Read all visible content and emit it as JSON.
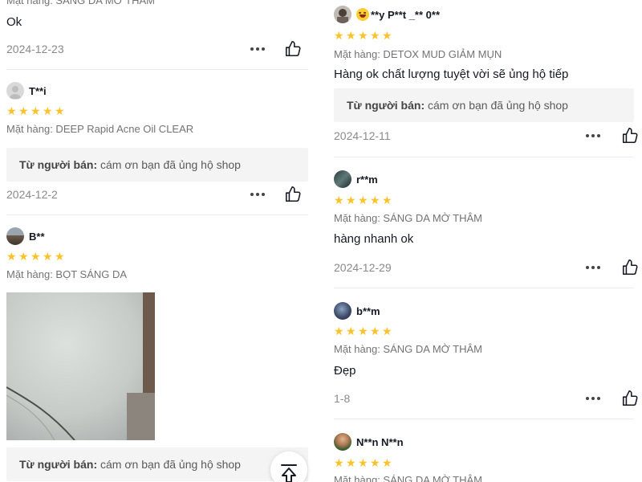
{
  "left_reviews": [
    {
      "variant": "Mặt hàng: SÁNG DA MỜ THÂM",
      "content": "Ok",
      "date": "2024-12-23"
    },
    {
      "username": "T**i",
      "variant": "Mặt hàng: DEEP Rapid Acne Oil CLEAR",
      "seller_label": "Từ người bán:",
      "seller_reply": "cám ơn bạn đã ủng hộ shop",
      "date": "2024-12-2"
    },
    {
      "username": "B**",
      "variant": "Mặt hàng: BỌT SÁNG DA",
      "seller_label": "Từ người bán:",
      "seller_reply": "cám ơn bạn đã ủng hộ shop"
    }
  ],
  "right_reviews": [
    {
      "username": "**y P**t _** 0**",
      "variant": "Mặt hàng: DETOX MUD GIẢM MỤN",
      "content": "Hàng ok chất lượng tuyệt vời sẽ ủng hộ tiếp",
      "seller_label": "Từ người bán:",
      "seller_reply": "cám ơn bạn đã ủng hộ shop",
      "date": "2024-12-11"
    },
    {
      "username": "r**m",
      "variant": "Mặt hàng: SÁNG DA MỜ THÂM",
      "content": "hàng nhanh ok",
      "date": "2024-12-29"
    },
    {
      "username": "b**m",
      "variant": "Mặt hàng: SÁNG DA MỜ THÂM",
      "content": "Đẹp",
      "date": "1-8"
    },
    {
      "username": "N**n N**n",
      "variant": "Mặt hàng: SÁNG DA MỜ THÂM"
    }
  ],
  "rating": 5,
  "star_glyph": "★",
  "colors": {
    "star": "#fdc22a",
    "text": "#161823",
    "muted": "#737373",
    "seller_bg": "#f4f4f4"
  },
  "icons": [
    "more-options-icon",
    "thumbs-up-icon",
    "scroll-to-top-icon",
    "laughing-emoji-icon"
  ]
}
